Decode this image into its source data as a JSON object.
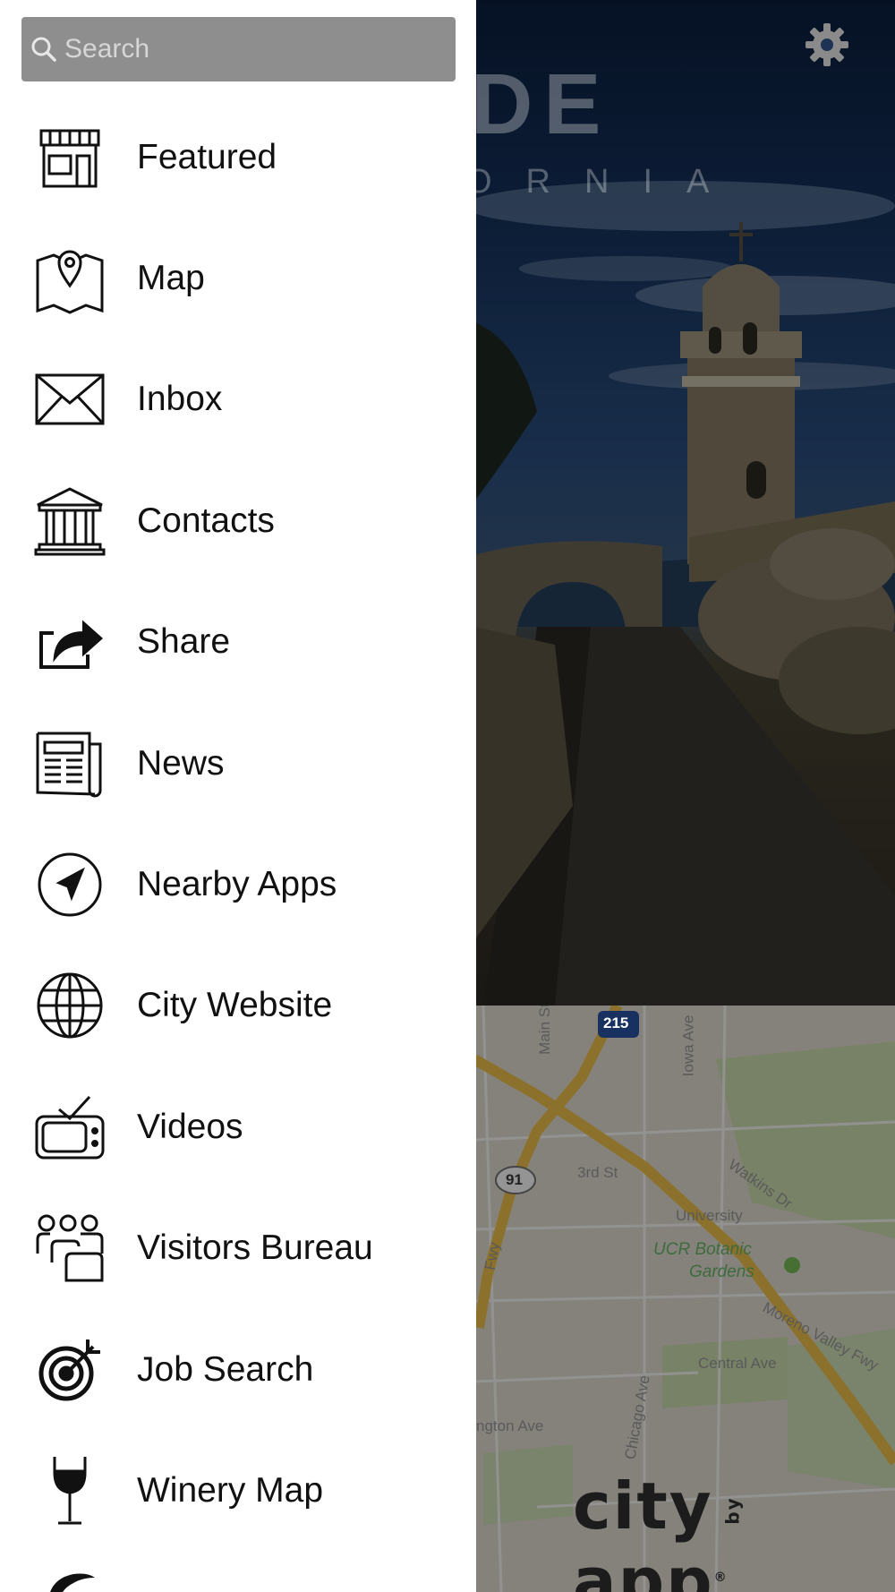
{
  "search": {
    "placeholder": "Search"
  },
  "header": {
    "title_fragment": "RSIDE",
    "subtitle_fragment": "ORNIA"
  },
  "menu": {
    "items": [
      {
        "label": "Featured",
        "icon": "storefront-icon"
      },
      {
        "label": "Map",
        "icon": "map-pin-icon"
      },
      {
        "label": "Inbox",
        "icon": "envelope-icon"
      },
      {
        "label": "Contacts",
        "icon": "building-columns-icon"
      },
      {
        "label": "Share",
        "icon": "share-arrow-icon"
      },
      {
        "label": "News",
        "icon": "newspaper-icon"
      },
      {
        "label": "Nearby Apps",
        "icon": "location-arrow-icon"
      },
      {
        "label": "City Website",
        "icon": "globe-icon"
      },
      {
        "label": "Videos",
        "icon": "tv-icon"
      },
      {
        "label": "Visitors Bureau",
        "icon": "people-group-icon"
      },
      {
        "label": "Job Search",
        "icon": "target-icon"
      },
      {
        "label": "Winery Map",
        "icon": "wine-glass-icon"
      }
    ]
  },
  "map": {
    "labels": [
      "Main St",
      "215",
      "Iowa Ave",
      "3rd St",
      "91",
      "Watkins Dr",
      "University",
      "UCR Botanic",
      "Gardens",
      "Moreno Valley Fwy",
      "Chicago Ave",
      "Central Ave",
      "ngton Ave",
      "Fwy"
    ]
  },
  "brand": {
    "part1": "city",
    "part2": "by",
    "part3": "app"
  },
  "colors": {
    "drawer_bg": "#ffffff",
    "search_bg": "#8e8e8e",
    "overlay": "rgba(0,0,0,0.42)"
  }
}
